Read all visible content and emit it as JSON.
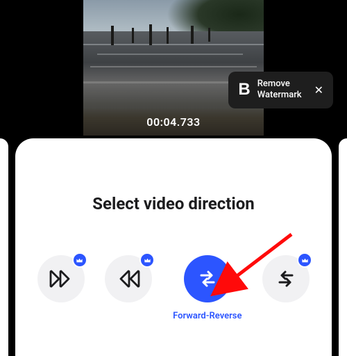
{
  "video": {
    "timestamp": "00:04.733"
  },
  "watermark": {
    "brand_letter": "B",
    "label_line1": "Remove",
    "label_line2": "Watermark",
    "close": "✕"
  },
  "panel": {
    "title": "Select video direction"
  },
  "options": {
    "forward": {
      "premium": true
    },
    "reverse": {
      "premium": true
    },
    "forward_reverse": {
      "label": "Forward-Reverse",
      "active": true
    },
    "reverse_forward": {
      "premium": true
    }
  },
  "colors": {
    "accent": "#2c55ff",
    "arrow": "#ff0a0a"
  }
}
